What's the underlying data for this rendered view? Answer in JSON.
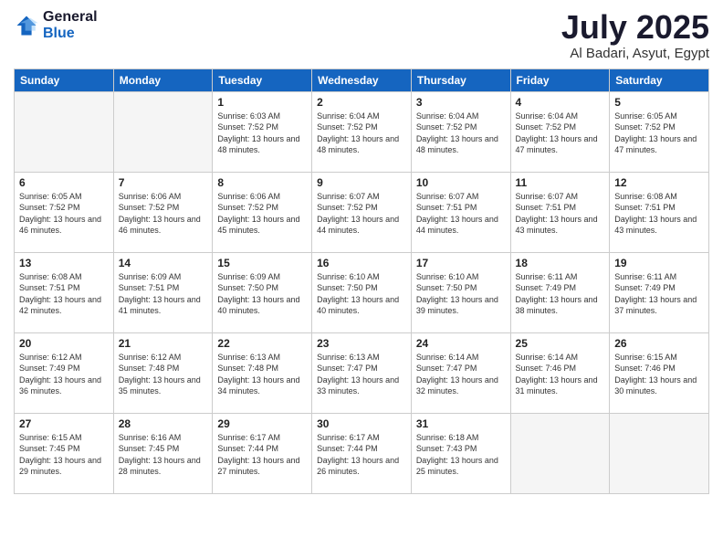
{
  "logo": {
    "general": "General",
    "blue": "Blue"
  },
  "header": {
    "title": "July 2025",
    "subtitle": "Al Badari, Asyut, Egypt"
  },
  "weekdays": [
    "Sunday",
    "Monday",
    "Tuesday",
    "Wednesday",
    "Thursday",
    "Friday",
    "Saturday"
  ],
  "weeks": [
    [
      {
        "day": "",
        "empty": true
      },
      {
        "day": "",
        "empty": true
      },
      {
        "day": "1",
        "sunrise": "6:03 AM",
        "sunset": "7:52 PM",
        "daylight": "13 hours and 48 minutes."
      },
      {
        "day": "2",
        "sunrise": "6:04 AM",
        "sunset": "7:52 PM",
        "daylight": "13 hours and 48 minutes."
      },
      {
        "day": "3",
        "sunrise": "6:04 AM",
        "sunset": "7:52 PM",
        "daylight": "13 hours and 48 minutes."
      },
      {
        "day": "4",
        "sunrise": "6:04 AM",
        "sunset": "7:52 PM",
        "daylight": "13 hours and 47 minutes."
      },
      {
        "day": "5",
        "sunrise": "6:05 AM",
        "sunset": "7:52 PM",
        "daylight": "13 hours and 47 minutes."
      }
    ],
    [
      {
        "day": "6",
        "sunrise": "6:05 AM",
        "sunset": "7:52 PM",
        "daylight": "13 hours and 46 minutes."
      },
      {
        "day": "7",
        "sunrise": "6:06 AM",
        "sunset": "7:52 PM",
        "daylight": "13 hours and 46 minutes."
      },
      {
        "day": "8",
        "sunrise": "6:06 AM",
        "sunset": "7:52 PM",
        "daylight": "13 hours and 45 minutes."
      },
      {
        "day": "9",
        "sunrise": "6:07 AM",
        "sunset": "7:52 PM",
        "daylight": "13 hours and 44 minutes."
      },
      {
        "day": "10",
        "sunrise": "6:07 AM",
        "sunset": "7:51 PM",
        "daylight": "13 hours and 44 minutes."
      },
      {
        "day": "11",
        "sunrise": "6:07 AM",
        "sunset": "7:51 PM",
        "daylight": "13 hours and 43 minutes."
      },
      {
        "day": "12",
        "sunrise": "6:08 AM",
        "sunset": "7:51 PM",
        "daylight": "13 hours and 43 minutes."
      }
    ],
    [
      {
        "day": "13",
        "sunrise": "6:08 AM",
        "sunset": "7:51 PM",
        "daylight": "13 hours and 42 minutes."
      },
      {
        "day": "14",
        "sunrise": "6:09 AM",
        "sunset": "7:51 PM",
        "daylight": "13 hours and 41 minutes."
      },
      {
        "day": "15",
        "sunrise": "6:09 AM",
        "sunset": "7:50 PM",
        "daylight": "13 hours and 40 minutes."
      },
      {
        "day": "16",
        "sunrise": "6:10 AM",
        "sunset": "7:50 PM",
        "daylight": "13 hours and 40 minutes."
      },
      {
        "day": "17",
        "sunrise": "6:10 AM",
        "sunset": "7:50 PM",
        "daylight": "13 hours and 39 minutes."
      },
      {
        "day": "18",
        "sunrise": "6:11 AM",
        "sunset": "7:49 PM",
        "daylight": "13 hours and 38 minutes."
      },
      {
        "day": "19",
        "sunrise": "6:11 AM",
        "sunset": "7:49 PM",
        "daylight": "13 hours and 37 minutes."
      }
    ],
    [
      {
        "day": "20",
        "sunrise": "6:12 AM",
        "sunset": "7:49 PM",
        "daylight": "13 hours and 36 minutes."
      },
      {
        "day": "21",
        "sunrise": "6:12 AM",
        "sunset": "7:48 PM",
        "daylight": "13 hours and 35 minutes."
      },
      {
        "day": "22",
        "sunrise": "6:13 AM",
        "sunset": "7:48 PM",
        "daylight": "13 hours and 34 minutes."
      },
      {
        "day": "23",
        "sunrise": "6:13 AM",
        "sunset": "7:47 PM",
        "daylight": "13 hours and 33 minutes."
      },
      {
        "day": "24",
        "sunrise": "6:14 AM",
        "sunset": "7:47 PM",
        "daylight": "13 hours and 32 minutes."
      },
      {
        "day": "25",
        "sunrise": "6:14 AM",
        "sunset": "7:46 PM",
        "daylight": "13 hours and 31 minutes."
      },
      {
        "day": "26",
        "sunrise": "6:15 AM",
        "sunset": "7:46 PM",
        "daylight": "13 hours and 30 minutes."
      }
    ],
    [
      {
        "day": "27",
        "sunrise": "6:15 AM",
        "sunset": "7:45 PM",
        "daylight": "13 hours and 29 minutes."
      },
      {
        "day": "28",
        "sunrise": "6:16 AM",
        "sunset": "7:45 PM",
        "daylight": "13 hours and 28 minutes."
      },
      {
        "day": "29",
        "sunrise": "6:17 AM",
        "sunset": "7:44 PM",
        "daylight": "13 hours and 27 minutes."
      },
      {
        "day": "30",
        "sunrise": "6:17 AM",
        "sunset": "7:44 PM",
        "daylight": "13 hours and 26 minutes."
      },
      {
        "day": "31",
        "sunrise": "6:18 AM",
        "sunset": "7:43 PM",
        "daylight": "13 hours and 25 minutes."
      },
      {
        "day": "",
        "empty": true
      },
      {
        "day": "",
        "empty": true
      }
    ]
  ],
  "labels": {
    "sunrise": "Sunrise:",
    "sunset": "Sunset:",
    "daylight": "Daylight:"
  }
}
